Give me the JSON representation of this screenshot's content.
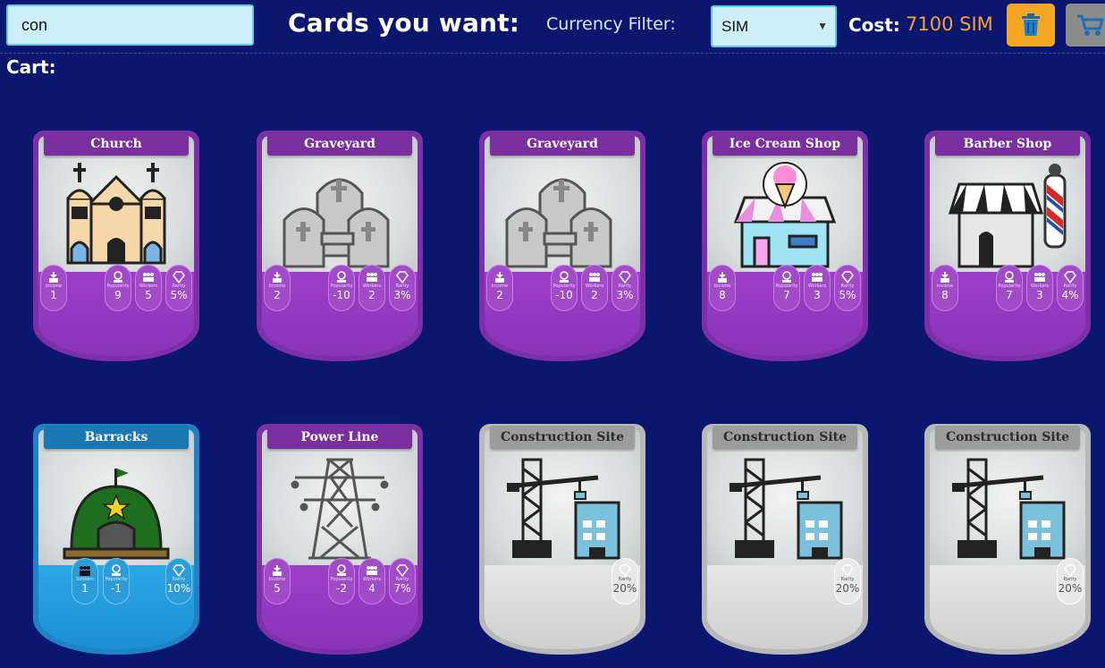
{
  "search": {
    "value": "con"
  },
  "header": {
    "title": "Cards you want:",
    "currency_label": "Currency Filter:",
    "currency_selected": "SIM",
    "cost_label": "Cost:",
    "cost_value": "7100 SIM",
    "trash_icon": "trash-icon",
    "cart_icon": "cart-icon"
  },
  "cart": {
    "title": "Cart:"
  },
  "colors": {
    "background": "#0b166e",
    "accent": "#f5a623",
    "cost": "#f5a13c",
    "purple": "#8a34b8",
    "blue": "#1d8fd0",
    "gray": "#cfcfcf"
  },
  "cards": [
    {
      "name": "Church",
      "theme": "purple",
      "icon": "church-icon",
      "stats": [
        {
          "label": "Income",
          "value": "1"
        },
        {
          "label": "Popularity",
          "value": "9"
        },
        {
          "label": "Workers",
          "value": "5"
        },
        {
          "label": "Rarity",
          "value": "5%"
        }
      ]
    },
    {
      "name": "Graveyard",
      "theme": "purple",
      "icon": "graveyard-icon",
      "stats": [
        {
          "label": "Income",
          "value": "2"
        },
        {
          "label": "Popularity",
          "value": "-10"
        },
        {
          "label": "Workers",
          "value": "2"
        },
        {
          "label": "Rarity",
          "value": "3%"
        }
      ]
    },
    {
      "name": "Graveyard",
      "theme": "purple",
      "icon": "graveyard-icon",
      "stats": [
        {
          "label": "Income",
          "value": "2"
        },
        {
          "label": "Popularity",
          "value": "-10"
        },
        {
          "label": "Workers",
          "value": "2"
        },
        {
          "label": "Rarity",
          "value": "3%"
        }
      ]
    },
    {
      "name": "Ice Cream Shop",
      "theme": "purple",
      "icon": "ice-cream-shop-icon",
      "stats": [
        {
          "label": "Income",
          "value": "8"
        },
        {
          "label": "Popularity",
          "value": "7"
        },
        {
          "label": "Workers",
          "value": "3"
        },
        {
          "label": "Rarity",
          "value": "5%"
        }
      ]
    },
    {
      "name": "Barber Shop",
      "theme": "purple",
      "icon": "barber-shop-icon",
      "stats": [
        {
          "label": "Income",
          "value": "8"
        },
        {
          "label": "Popularity",
          "value": "7"
        },
        {
          "label": "Workers",
          "value": "3"
        },
        {
          "label": "Rarity",
          "value": "4%"
        }
      ]
    },
    {
      "name": "Barracks",
      "theme": "blue",
      "icon": "barracks-icon",
      "stats": [
        {
          "label": "Soldiers",
          "value": "1"
        },
        {
          "label": "Popularity",
          "value": "-1"
        },
        {
          "label": "Rarity",
          "value": "10%"
        }
      ]
    },
    {
      "name": "Power Line",
      "theme": "purple",
      "icon": "power-line-icon",
      "stats": [
        {
          "label": "Income",
          "value": "5"
        },
        {
          "label": "Popularity",
          "value": "-2"
        },
        {
          "label": "Workers",
          "value": "4"
        },
        {
          "label": "Rarity",
          "value": "7%"
        }
      ]
    },
    {
      "name": "Construction Site",
      "theme": "gray",
      "icon": "construction-site-icon",
      "stats": [
        {
          "label": "Rarity",
          "value": "20%"
        }
      ]
    },
    {
      "name": "Construction Site",
      "theme": "gray",
      "icon": "construction-site-icon",
      "stats": [
        {
          "label": "Rarity",
          "value": "20%"
        }
      ]
    },
    {
      "name": "Construction Site",
      "theme": "gray",
      "icon": "construction-site-icon",
      "stats": [
        {
          "label": "Rarity",
          "value": "20%"
        }
      ]
    }
  ]
}
